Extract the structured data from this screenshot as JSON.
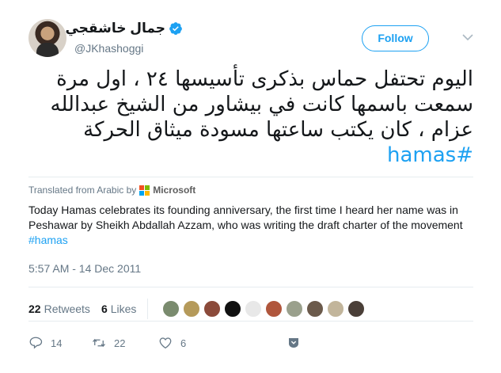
{
  "author": {
    "display_name": "جمال خاشقجي",
    "handle": "@JKhashoggi"
  },
  "follow_label": "Follow",
  "tweet": {
    "lines": [
      "اليوم تحتفل حماس بذكرى تأسيسها ٢٤ ، اول مرة",
      "سمعت باسمها كانت في بيشاور من الشيخ عبدالله",
      "عزام ، كان يكتب ساعتها مسودة ميثاق الحركة"
    ],
    "hashtag": "#hamas"
  },
  "translation": {
    "label": "Translated from Arabic by",
    "provider": "Microsoft",
    "text": "Today Hamas celebrates its founding anniversary, the first time I heard her name was in Peshawar by Sheikh Abdallah Azzam, who was writing the draft charter of the movement",
    "hashtag": "#hamas"
  },
  "timestamp": "5:57 AM - 14 Dec 2011",
  "stats": {
    "retweets_count": "22",
    "retweets_label": "Retweets",
    "likes_count": "6",
    "likes_label": "Likes"
  },
  "likers": [
    {
      "color": "#7a8b6e"
    },
    {
      "color": "#b59a5a"
    },
    {
      "color": "#8b4a3a"
    },
    {
      "color": "#111111"
    },
    {
      "color": "#e8e8e8"
    },
    {
      "color": "#b0563c"
    },
    {
      "color": "#9aa08c"
    },
    {
      "color": "#6b5a4b"
    },
    {
      "color": "#c2b59b"
    },
    {
      "color": "#4a3f38"
    }
  ],
  "actions": {
    "replies": "14",
    "retweets": "22",
    "likes": "6"
  },
  "colors": {
    "accent": "#1da1f2",
    "secondary_text": "#657786",
    "divider": "#e6ecf0"
  }
}
